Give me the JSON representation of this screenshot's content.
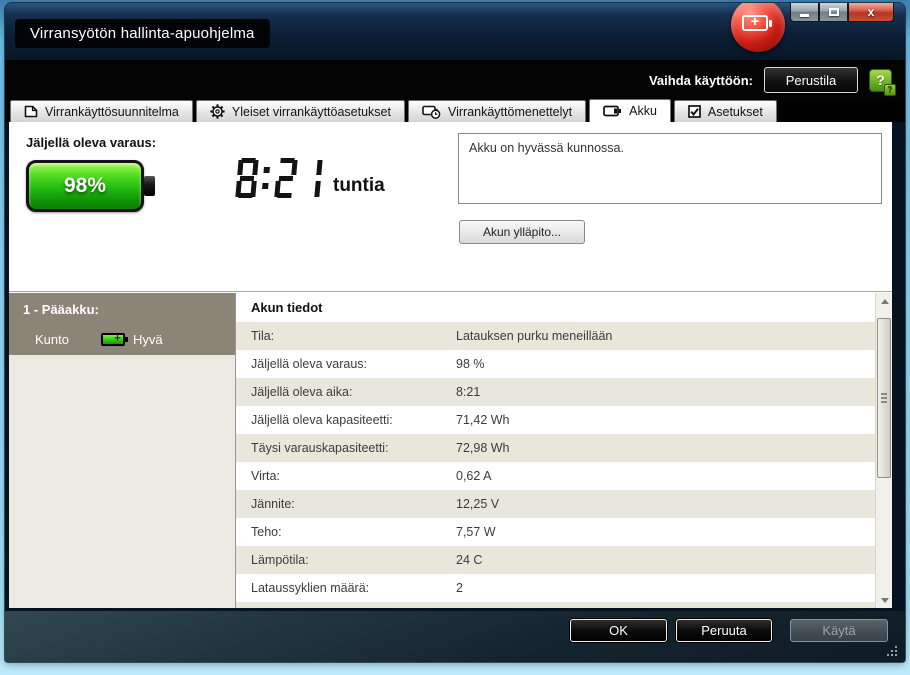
{
  "window": {
    "title": "Virransyötön hallinta-apuohjelma",
    "controls": [
      "minimize",
      "maximize",
      "close"
    ]
  },
  "mode_switcher": {
    "label": "Vaihda käyttöön:",
    "button_label": "Perustila",
    "help_icon": "help-icon"
  },
  "tabs": [
    {
      "label": "Virrankäyttösuunnitelma",
      "icon": "power-plan-icon",
      "active": false
    },
    {
      "label": "Yleiset virrankäyttöasetukset",
      "icon": "gear-icon",
      "active": false
    },
    {
      "label": "Virrankäyttömenettelyt",
      "icon": "battery-clock-icon",
      "active": false
    },
    {
      "label": "Akku",
      "icon": "battery-icon",
      "active": true
    },
    {
      "label": "Asetukset",
      "icon": "checkbox-icon",
      "active": false
    }
  ],
  "overview": {
    "charge_label": "Jäljellä oleva varaus:",
    "charge_percent": "98%",
    "time_value": "8:21",
    "time_unit": "tuntia",
    "status_message": "Akku on hyvässä kunnossa.",
    "maintenance_button": "Akun ylläpito..."
  },
  "battery_list": {
    "item_title": "1 - Pääakku:",
    "condition_label": "Kunto",
    "condition_value": "Hyvä",
    "condition_icon": "mini-battery-icon"
  },
  "details": {
    "title": "Akun tiedot",
    "rows": [
      {
        "label": "Tila:",
        "value": "Latauksen purku meneillään"
      },
      {
        "label": "Jäljellä oleva varaus:",
        "value": "98 %"
      },
      {
        "label": "Jäljellä oleva aika:",
        "value": "8:21"
      },
      {
        "label": "Jäljellä oleva kapasiteetti:",
        "value": "71,42 Wh"
      },
      {
        "label": "Täysi varauskapasiteetti:",
        "value": "72,98 Wh"
      },
      {
        "label": "Virta:",
        "value": "0,62 A"
      },
      {
        "label": "Jännite:",
        "value": "12,25 V"
      },
      {
        "label": "Teho:",
        "value": "7,57 W"
      },
      {
        "label": "Lämpötila:",
        "value": "24 C"
      },
      {
        "label": "Lataussyklien määrä:",
        "value": "2"
      }
    ]
  },
  "footer": {
    "ok": "OK",
    "cancel": "Peruuta",
    "apply": "Käytä"
  },
  "colors": {
    "battery_green": "#2fc714",
    "title_bar_blue": "#0c1d36",
    "command_bar_black": "#040404",
    "row_stripe_beige": "#e9e6dc",
    "selected_panel_taupe": "#8b8577",
    "close_button_red": "#b53524",
    "help_icon_green": "#6cb022",
    "app_icon_red": "#c51b12"
  }
}
